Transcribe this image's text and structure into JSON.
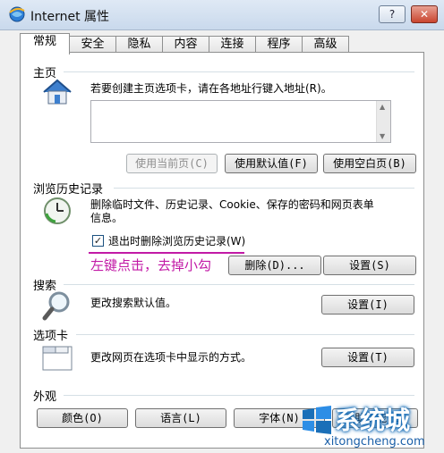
{
  "window": {
    "title": "Internet 属性",
    "help_label": "?",
    "close_label": "✕"
  },
  "tabs": [
    "常规",
    "安全",
    "隐私",
    "内容",
    "连接",
    "程序",
    "高级"
  ],
  "home": {
    "label": "主页",
    "description": "若要创建主页选项卡，请在各地址行键入地址(R)。",
    "address_value": "",
    "buttons": {
      "use_current": "使用当前页(C)",
      "use_default": "使用默认值(F)",
      "use_blank": "使用空白页(B)"
    }
  },
  "history": {
    "label": "浏览历史记录",
    "description_line1": "删除临时文件、历史记录、Cookie、保存的密码和网页表单",
    "description_line2": "信息。",
    "checkbox_label": "退出时删除浏览历史记录(W)",
    "checkbox_checked": true,
    "delete_button": "删除(D)...",
    "settings_button": "设置(S)"
  },
  "annotation": {
    "text": "左键点击，去掉小勾",
    "color": "#c21aa6"
  },
  "search": {
    "label": "搜索",
    "description": "更改搜索默认值。",
    "settings_button": "设置(I)"
  },
  "tabbed": {
    "label": "选项卡",
    "description": "更改网页在选项卡中显示的方式。",
    "settings_button": "设置(T)"
  },
  "appearance": {
    "label": "外观",
    "buttons": {
      "colors": "颜色(O)",
      "languages": "语言(L)",
      "fonts": "字体(N)",
      "accessibility": "辅助功能(E)"
    }
  },
  "watermark": {
    "main": "系统城",
    "sub": "xitongcheng.com"
  }
}
